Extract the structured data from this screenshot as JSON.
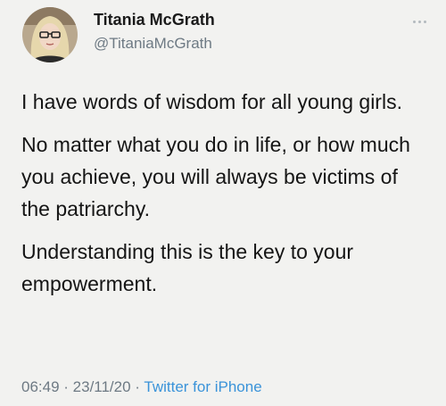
{
  "tweet": {
    "author": {
      "name": "Titania McGrath",
      "handle": "@TitaniaMcGrath",
      "avatar": "avatar-photo"
    },
    "menu_icon": "more-horizontal-icon",
    "paragraphs": [
      "I have words of wisdom for all young girls.",
      "No matter what you do in life, or how much you achieve, you will always be victims of the patriarchy.",
      "Understanding this is the key to your empowerment."
    ],
    "time": "06:49",
    "separator": " · ",
    "date": "23/11/20",
    "source": "Twitter for iPhone"
  },
  "colors": {
    "background": "#f2f2f0",
    "text": "#151515",
    "muted": "#6e7a84",
    "link": "#3a93d9"
  }
}
